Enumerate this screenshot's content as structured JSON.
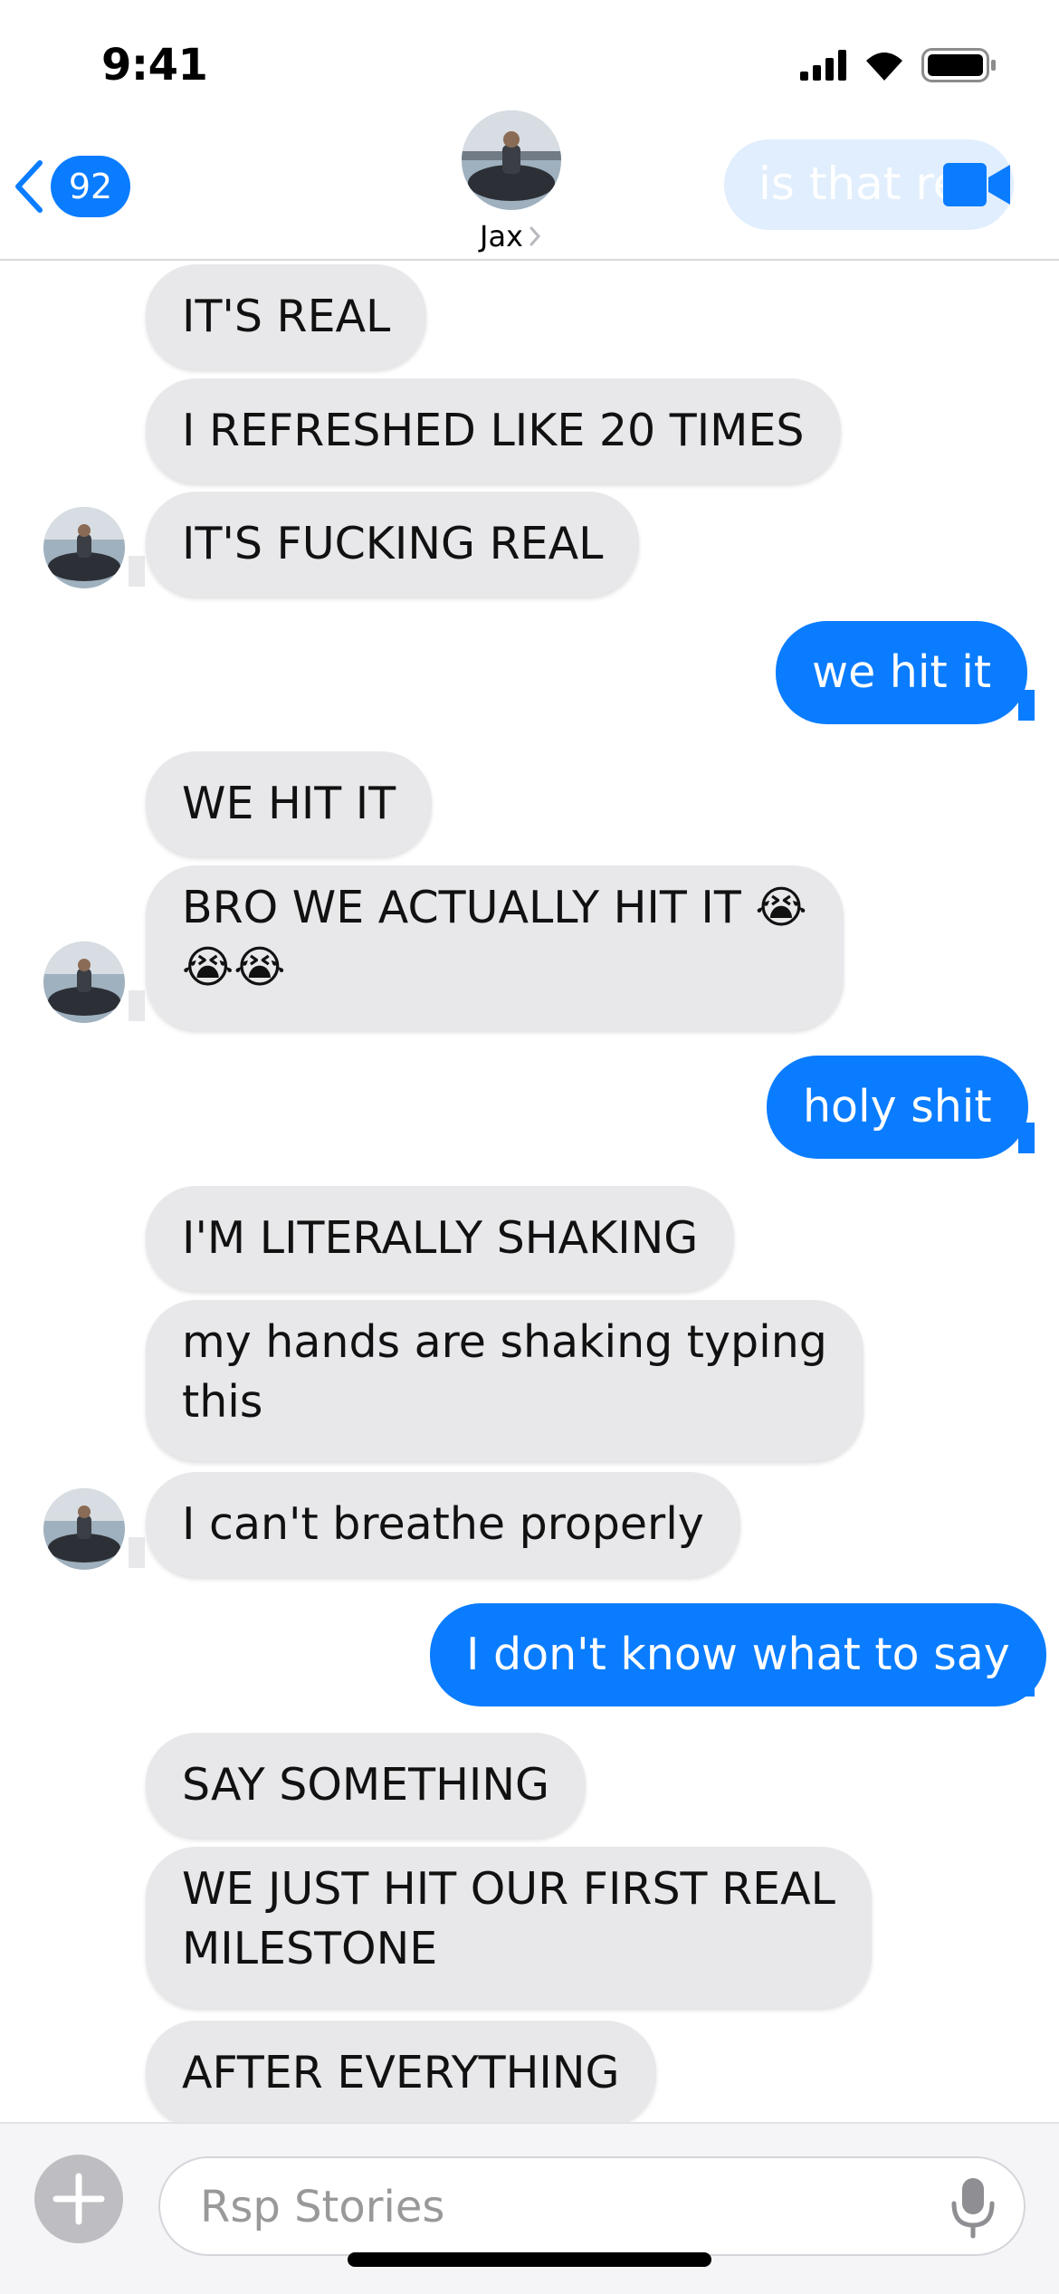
{
  "status_bar": {
    "time": "9:41"
  },
  "header": {
    "back_count": "92",
    "contact_name": "Jax",
    "preview_text": "is that re"
  },
  "messages": [
    {
      "direction": "received",
      "text": "IT'S REAL"
    },
    {
      "direction": "received",
      "text": "I REFRESHED LIKE 20 TIMES"
    },
    {
      "direction": "received",
      "text": "IT'S FUCKING REAL"
    },
    {
      "direction": "sent",
      "text": "we hit it"
    },
    {
      "direction": "received",
      "text": "WE HIT IT"
    },
    {
      "direction": "received",
      "lines": [
        "BRO WE ACTUALLY HIT IT 😭",
        "😭😭"
      ]
    },
    {
      "direction": "sent",
      "text": "holy shit"
    },
    {
      "direction": "received",
      "text": "I'M LITERALLY SHAKING"
    },
    {
      "direction": "received",
      "lines": [
        "my hands are shaking typing",
        "this"
      ]
    },
    {
      "direction": "received",
      "text": "I can't breathe properly"
    },
    {
      "direction": "sent",
      "text": "I don't know what to say"
    },
    {
      "direction": "received",
      "text": "SAY SOMETHING"
    },
    {
      "direction": "received",
      "lines": [
        "WE JUST HIT OUR FIRST REAL",
        "MILESTONE"
      ]
    },
    {
      "direction": "received",
      "text": "AFTER EVERYTHING"
    }
  ],
  "composer": {
    "placeholder": "Rsp Stories"
  },
  "icons": {
    "back": "chevron-left-icon",
    "video": "video-camera-icon",
    "add": "plus-icon",
    "mic": "microphone-icon",
    "signal": "signal-icon",
    "wifi": "wifi-icon",
    "battery": "battery-icon"
  },
  "colors": {
    "accent": "#0a7cff",
    "received_bubble": "#e8e8eb",
    "sent_bubble": "#0a7cff",
    "background": "#ffffff"
  }
}
